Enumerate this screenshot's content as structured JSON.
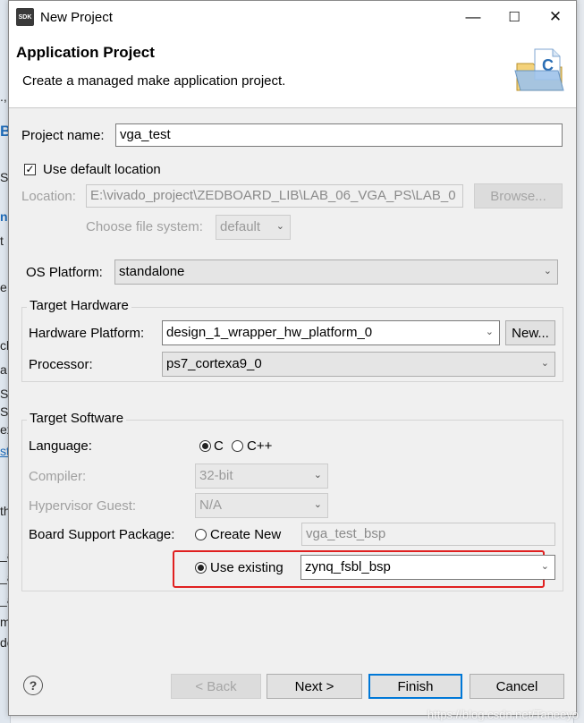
{
  "background": {
    "left_fragments": [
      "., s",
      "B",
      "S",
      "n",
      "t",
      "e",
      "ck",
      "a",
      "S",
      "S.",
      "St",
      "ex",
      "st",
      "th",
      "_a",
      "_a",
      "_a",
      "_a",
      "m",
      "dc"
    ]
  },
  "window": {
    "app_icon_text": "SDK",
    "title": "New Project",
    "minimize": "—",
    "maximize": "☐",
    "close": "✕"
  },
  "header": {
    "title": "Application Project",
    "description": "Create a managed make application project."
  },
  "form": {
    "project_name_label": "Project name:",
    "project_name_value": "vga_test",
    "use_default_location_label": "Use default location",
    "use_default_location_checked": true,
    "location_label": "Location:",
    "location_value": "E:\\vivado_project\\ZEDBOARD_LIB\\LAB_06_VGA_PS\\LAB_0",
    "browse_button": "Browse...",
    "file_system_label": "Choose file system:",
    "file_system_value": "default",
    "os_platform_label": "OS Platform:",
    "os_platform_value": "standalone"
  },
  "target_hardware": {
    "group_label": "Target Hardware",
    "hardware_platform_label": "Hardware Platform:",
    "hardware_platform_value": "design_1_wrapper_hw_platform_0",
    "new_button": "New...",
    "processor_label": "Processor:",
    "processor_value": "ps7_cortexa9_0"
  },
  "target_software": {
    "group_label": "Target Software",
    "language_label": "Language:",
    "language_options": [
      "C",
      "C++"
    ],
    "language_selected": "C",
    "compiler_label": "Compiler:",
    "compiler_value": "32-bit",
    "hypervisor_label": "Hypervisor Guest:",
    "hypervisor_value": "N/A",
    "bsp_label": "Board Support Package:",
    "create_new_label": "Create New",
    "create_new_value": "vga_test_bsp",
    "use_existing_label": "Use existing",
    "use_existing_value": "zynq_fsbl_bsp",
    "bsp_selected": "Use existing",
    "highlight_color": "#e02020"
  },
  "footer": {
    "help": "?",
    "back_button": "< Back",
    "next_button": "Next >",
    "finish_button": "Finish",
    "cancel_button": "Cancel"
  },
  "watermark": "https://blog.csdn.net/Taneeyo"
}
